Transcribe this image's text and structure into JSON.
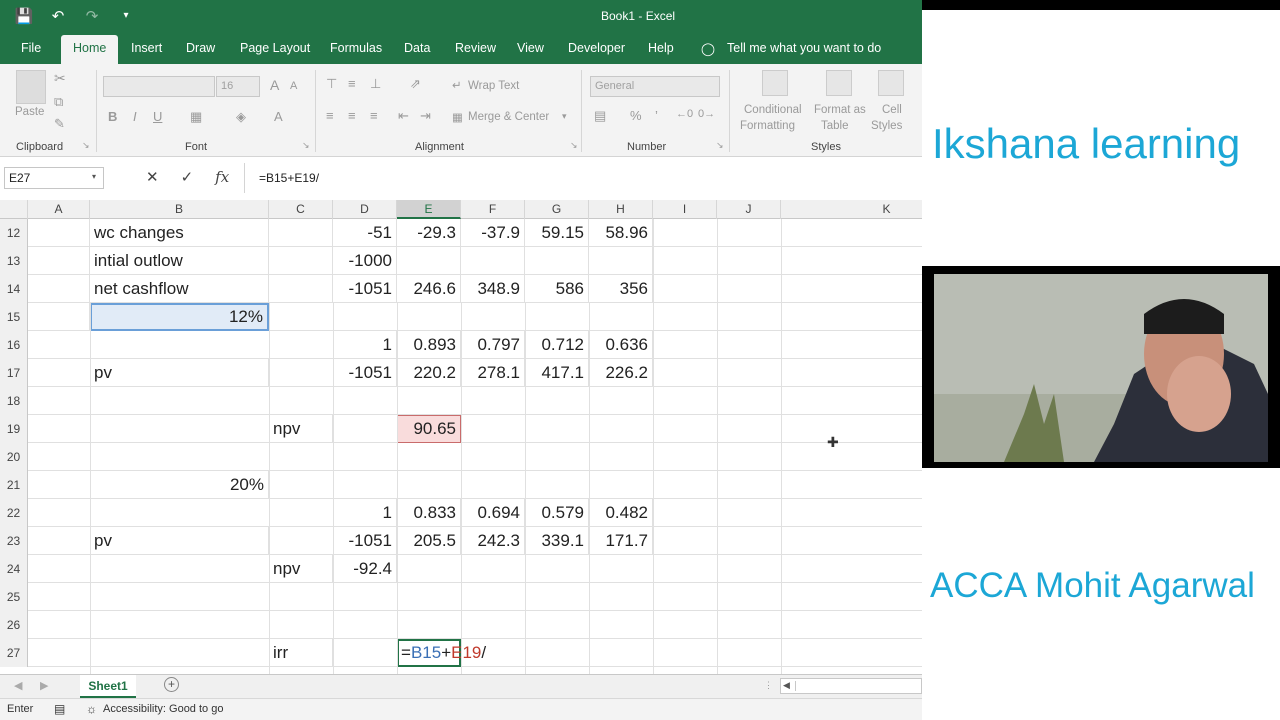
{
  "window": {
    "title": "Book1  -  Excel"
  },
  "ribbon": {
    "tabs": [
      "File",
      "Home",
      "Insert",
      "Draw",
      "Page Layout",
      "Formulas",
      "Data",
      "Review",
      "View",
      "Developer",
      "Help"
    ],
    "tell_me": "Tell me what you want to do",
    "groups": {
      "clipboard": "Clipboard",
      "font": "Font",
      "alignment": "Alignment",
      "number": "Number",
      "styles": "Styles"
    },
    "paste": "Paste",
    "font_size": "16",
    "number_format": "General",
    "wrap_text": "Wrap Text",
    "merge_center": "Merge & Center",
    "conditional_formatting": [
      "Conditional",
      "Formatting"
    ],
    "format_as_table": [
      "Format as",
      "Table"
    ],
    "cell_styles": [
      "Cell",
      "Styles"
    ]
  },
  "formula_bar": {
    "name_box": "E27",
    "formula": "=B15+E19/"
  },
  "columns": [
    "A",
    "B",
    "C",
    "D",
    "E",
    "F",
    "G",
    "H",
    "I",
    "J",
    "K"
  ],
  "rows": [
    {
      "n": "12",
      "b": "wc changes",
      "d": "-51",
      "e": "-29.3",
      "f": "-37.9",
      "g": "59.15",
      "h": "58.96"
    },
    {
      "n": "13",
      "b": "intial outlow",
      "d": "-1000"
    },
    {
      "n": "14",
      "b": "net cashflow",
      "d": "-1051",
      "e": "246.6",
      "f": "348.9",
      "g": "586",
      "h": "356"
    },
    {
      "n": "15",
      "b_num": "12%"
    },
    {
      "n": "16",
      "d": "1",
      "e": "0.893",
      "f": "0.797",
      "g": "0.712",
      "h": "0.636"
    },
    {
      "n": "17",
      "b": "pv",
      "d": "-1051",
      "e": "220.2",
      "f": "278.1",
      "g": "417.1",
      "h": "226.2"
    },
    {
      "n": "18"
    },
    {
      "n": "19",
      "c": "npv",
      "e": "90.65"
    },
    {
      "n": "20"
    },
    {
      "n": "21",
      "b_num": "20%"
    },
    {
      "n": "22",
      "d": "1",
      "e": "0.833",
      "f": "0.694",
      "g": "0.579",
      "h": "0.482"
    },
    {
      "n": "23",
      "b": "pv",
      "d": "-1051",
      "e": "205.5",
      "f": "242.3",
      "g": "339.1",
      "h": "171.7"
    },
    {
      "n": "24",
      "c": "npv",
      "d": "-92.4"
    },
    {
      "n": "25"
    },
    {
      "n": "26"
    },
    {
      "n": "27",
      "c": "irr"
    }
  ],
  "edit_cell": {
    "eq": "=",
    "ref1": "B15",
    "plus": "+",
    "ref2": "E19",
    "slash": "/"
  },
  "sheet": {
    "tab": "Sheet1"
  },
  "status": {
    "mode": "Enter",
    "accessibility": "Accessibility: Good to go"
  },
  "overlay": {
    "line1": "Ikshana learning",
    "line2": "ACCA Mohit Agarwal"
  },
  "colors": {
    "excel_green": "#217346",
    "overlay_text": "#1ca7d6"
  }
}
